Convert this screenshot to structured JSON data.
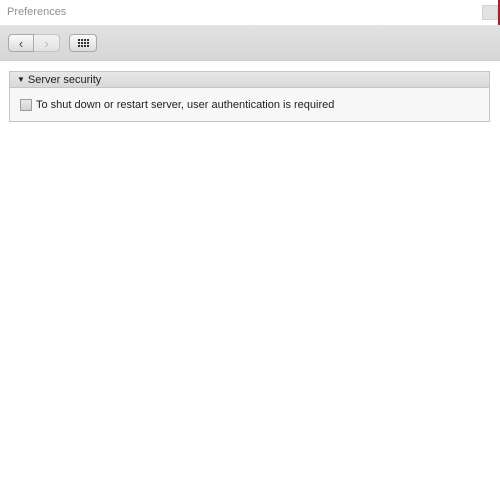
{
  "window": {
    "title": "Preferences",
    "accent_color": "#a61f2a"
  },
  "toolbar": {
    "back_glyph": "‹",
    "forward_glyph": "›",
    "back_icon": "chevron-left-icon",
    "forward_icon": "chevron-right-icon",
    "grid_icon": "grid-icon"
  },
  "sections": [
    {
      "title": "Server security",
      "expanded": true,
      "options": [
        {
          "label": "To shut down or restart server, user authentication is required",
          "checked": false
        }
      ]
    }
  ]
}
